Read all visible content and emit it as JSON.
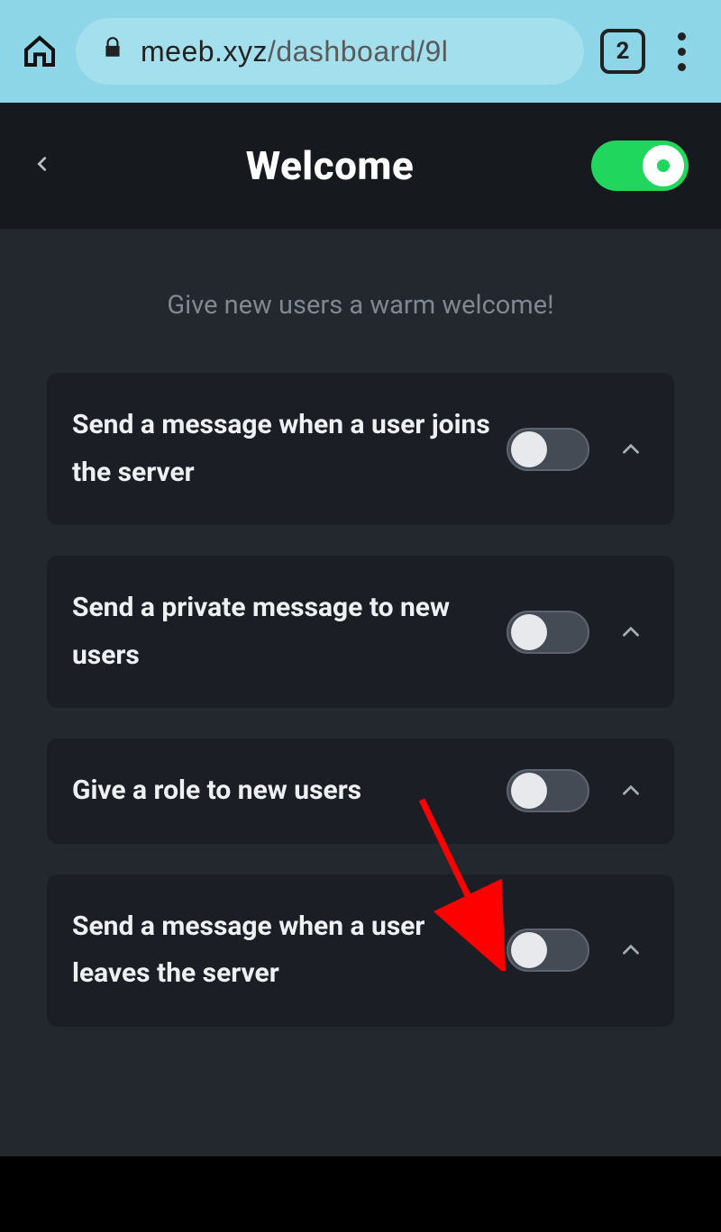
{
  "browser": {
    "url_domain": "meeb.xyz",
    "url_path": "/dashboard/9l",
    "tab_count": "2"
  },
  "header": {
    "title": "Welcome",
    "master_enabled": true
  },
  "subtitle": "Give new users a warm welcome!",
  "options": [
    {
      "label": "Send a message when a user joins the server",
      "enabled": false
    },
    {
      "label": "Send a private message to new users",
      "enabled": false
    },
    {
      "label": "Give a role to new users",
      "enabled": false
    },
    {
      "label": "Send a message when a user leaves the server",
      "enabled": false
    }
  ]
}
